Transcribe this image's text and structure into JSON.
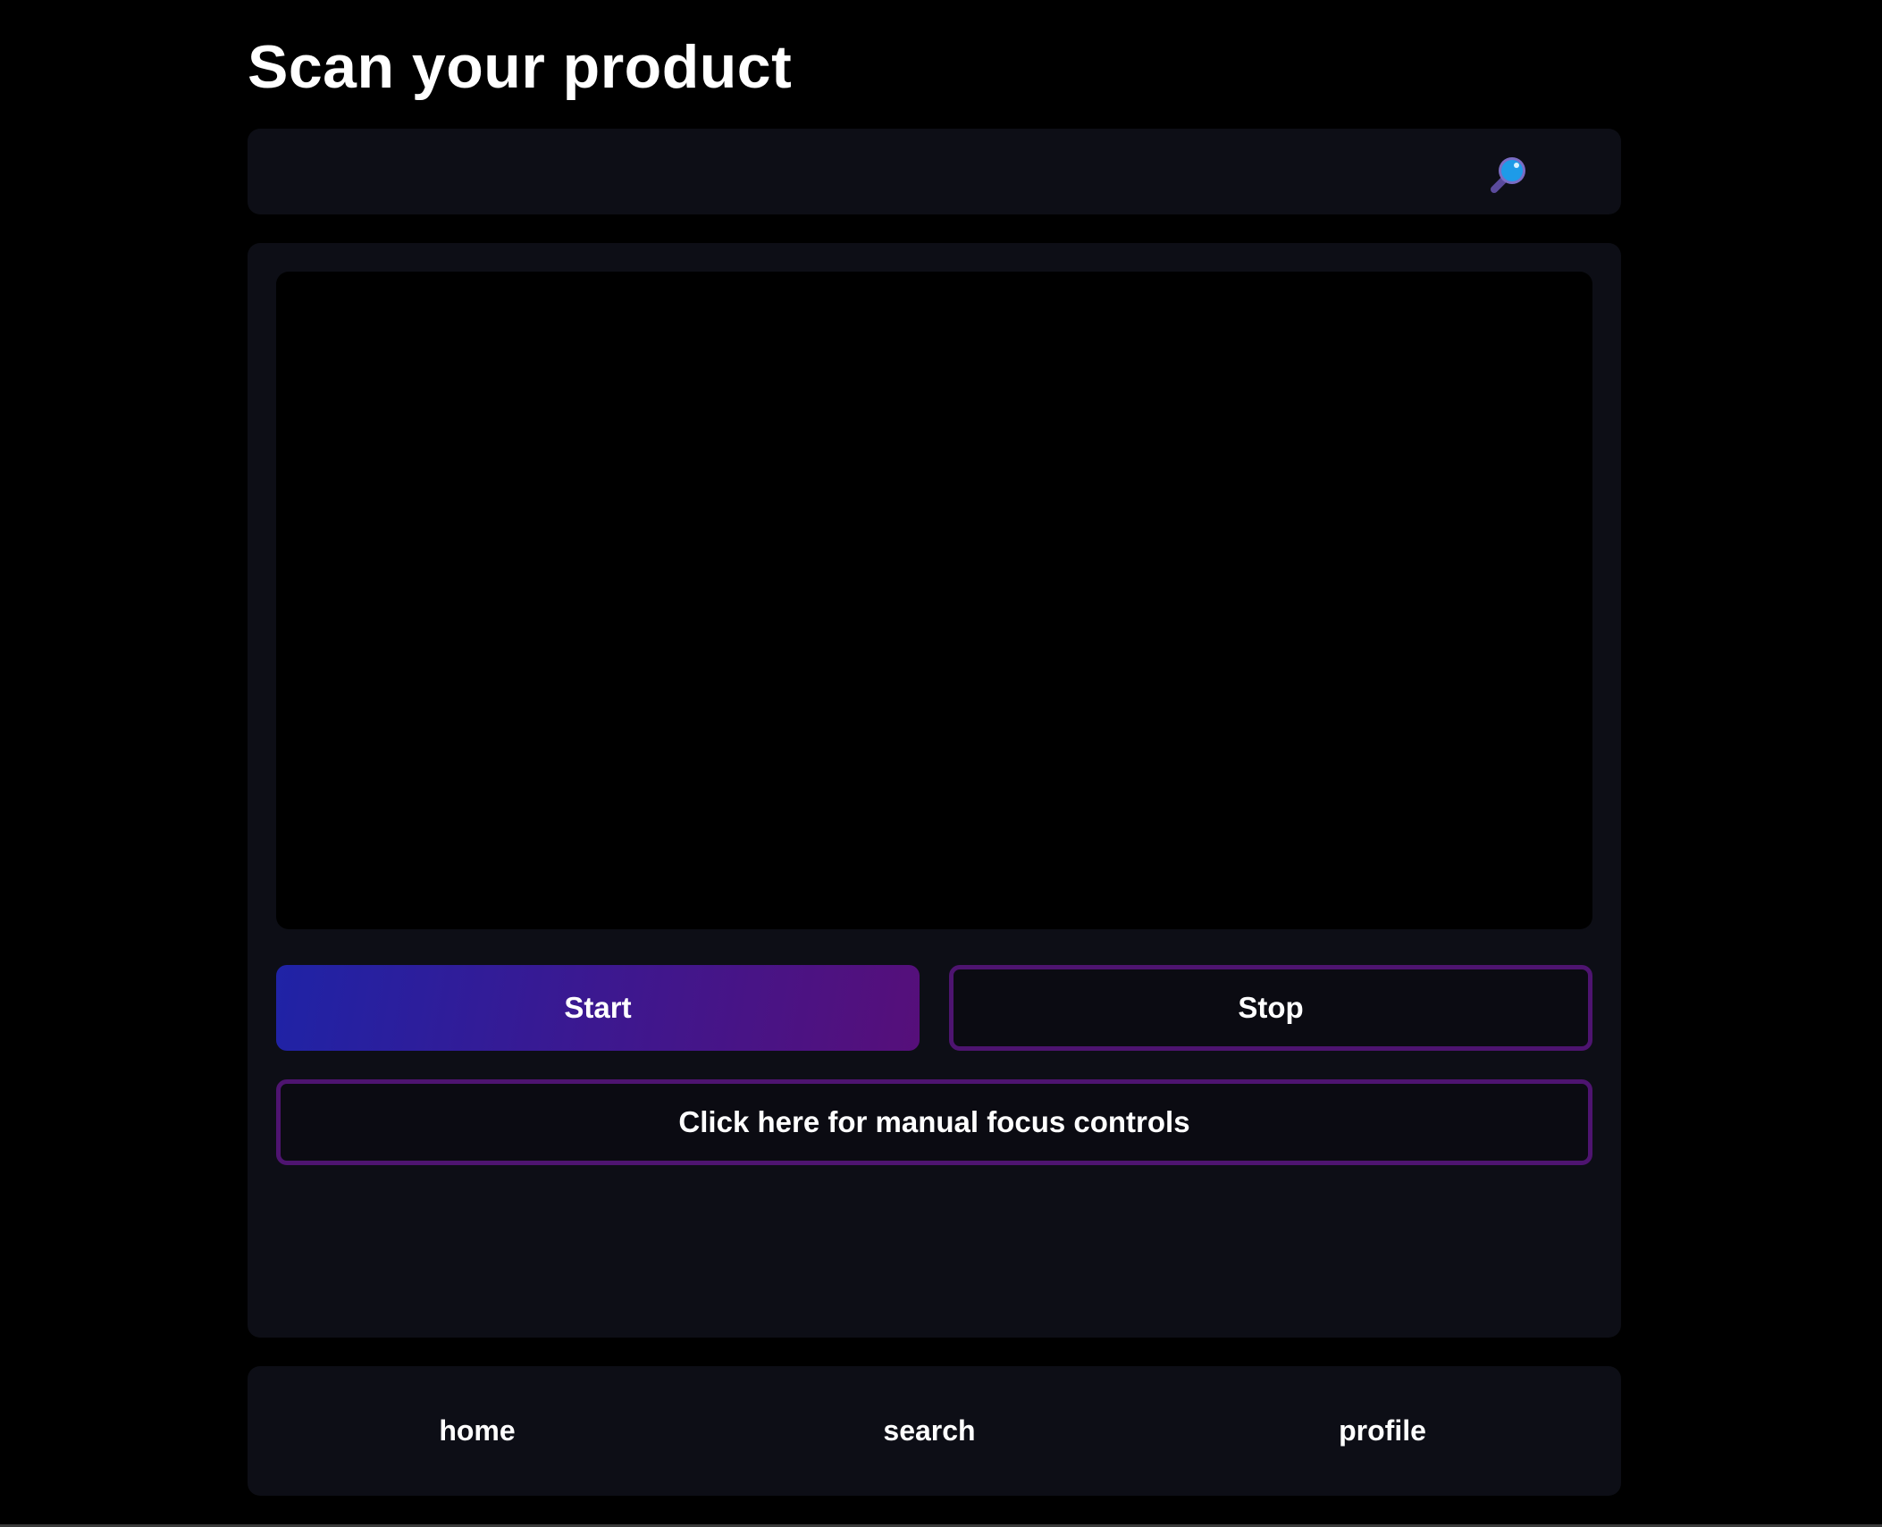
{
  "page": {
    "title": "Scan your product"
  },
  "search": {
    "icon": "magnifying-glass-icon",
    "icon_color": "#1e9be8"
  },
  "scanner": {
    "start_label": "Start",
    "stop_label": "Stop",
    "focus_label": "Click here for manual focus controls"
  },
  "nav": {
    "home_label": "home",
    "search_label": "search",
    "profile_label": "profile"
  },
  "colors": {
    "background": "#000000",
    "panel": "#0d0e16",
    "accent_start": "#1f23a6",
    "accent_end": "#560f7a",
    "outline": "#4e1470"
  }
}
